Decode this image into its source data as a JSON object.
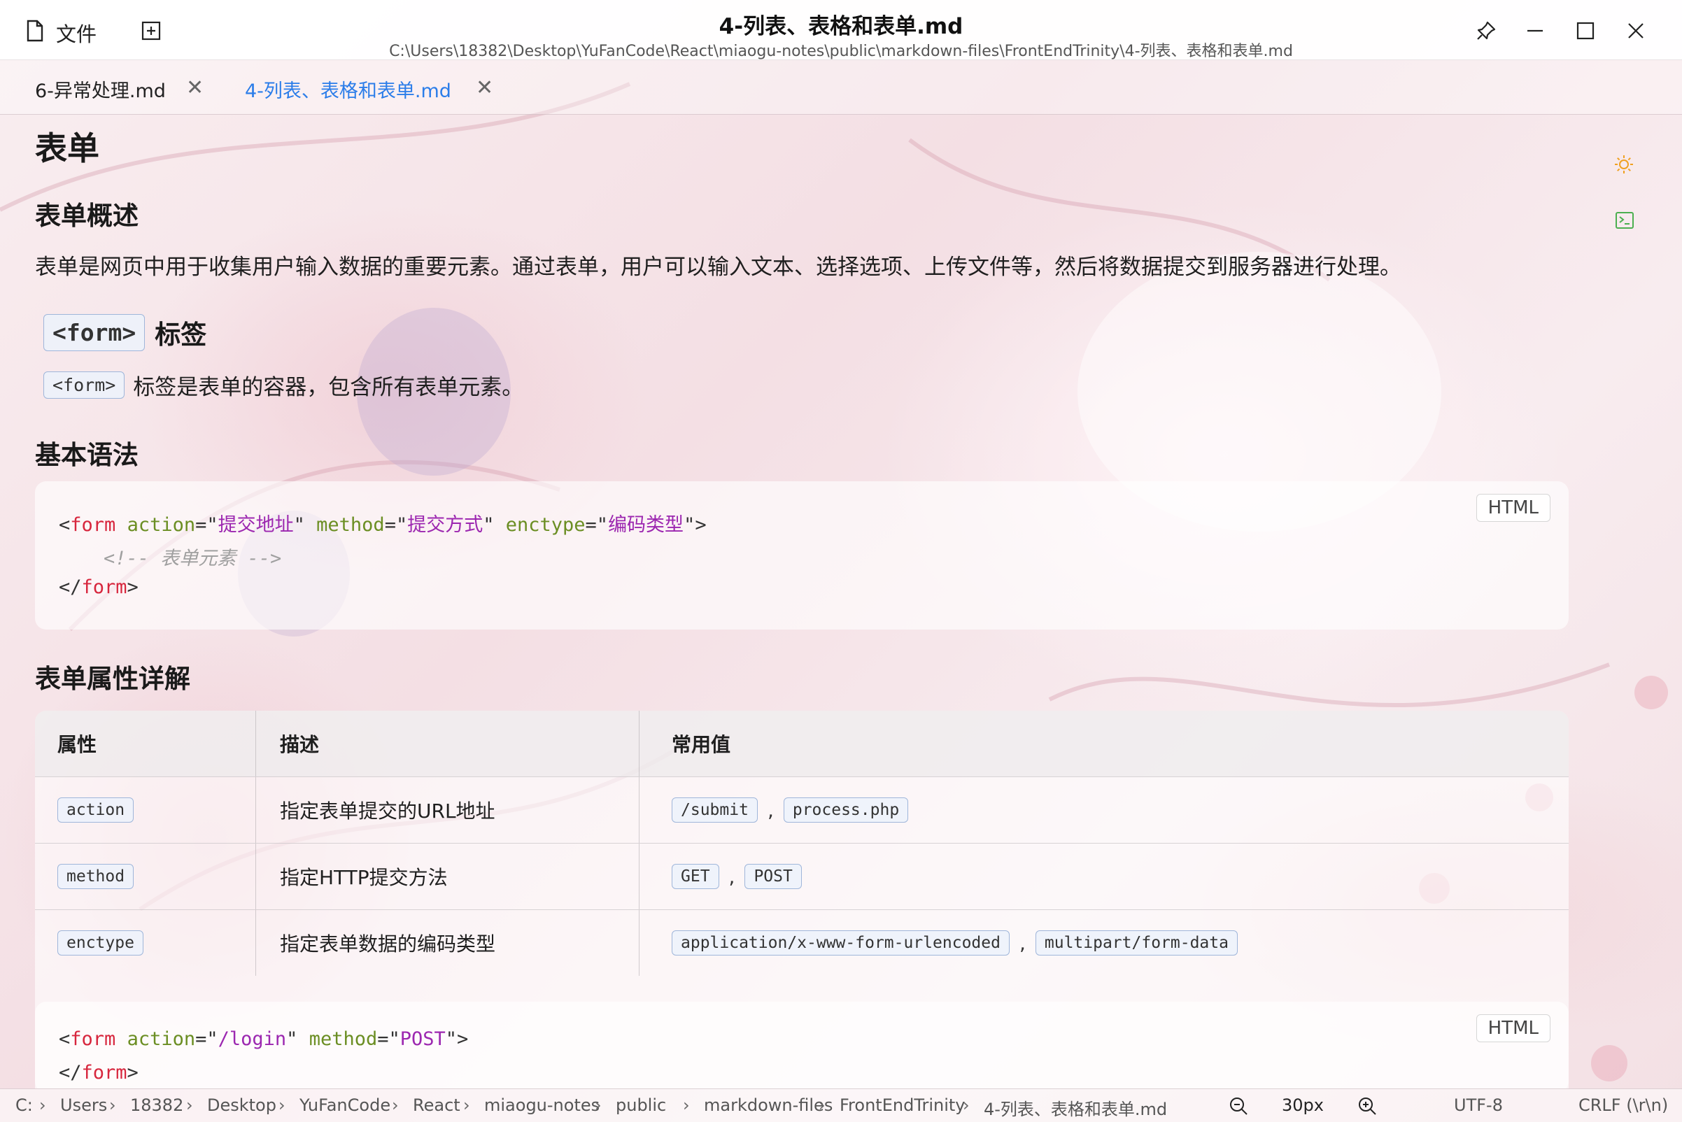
{
  "titlebar": {
    "file_label": "文件",
    "title": "4-列表、表格和表单.md",
    "path": "C:\\Users\\18382\\Desktop\\YuFanCode\\React\\miaogu-notes\\public\\markdown-files\\FrontEndTrinity\\4-列表、表格和表单.md"
  },
  "tabs": [
    {
      "label": "6-异常处理.md",
      "active": false
    },
    {
      "label": "4-列表、表格和表单.md",
      "active": true
    }
  ],
  "doc": {
    "h1": "表单",
    "h2_overview": "表单概述",
    "p_overview": "表单是网页中用于收集用户输入数据的重要元素。通过表单，用户可以输入文本、选择选项、上传文件等，然后将数据提交到服务器进行处理。",
    "h2_formtag_code": "<form>",
    "h2_formtag_text": "标签",
    "p_formtag_code": "<form>",
    "p_formtag_text": "标签是表单的容器，包含所有表单元素。",
    "h2_syntax": "基本语法",
    "h2_attrs": "表单属性详解"
  },
  "code1": {
    "lang": "HTML",
    "l1": {
      "lt": "<",
      "tag": "form",
      "a1": "action",
      "eq1": "=\"",
      "v1": "提交地址",
      "q1": "\"",
      "a2": "method",
      "eq2": "=\"",
      "v2": "提交方式",
      "q2": "\"",
      "a3": "enctype",
      "eq3": "=\"",
      "v3": "编码类型",
      "q3": "\">"
    },
    "l2": "<!-- 表单元素 -->",
    "l3": {
      "lt": "</",
      "tag": "form",
      "gt": ">"
    }
  },
  "table": {
    "headers": [
      "属性",
      "描述",
      "常用值"
    ],
    "rows": [
      {
        "attr": "action",
        "desc": "指定表单提交的URL地址",
        "values": [
          "/submit",
          "process.php"
        ]
      },
      {
        "attr": "method",
        "desc": "指定HTTP提交方法",
        "values": [
          "GET",
          "POST"
        ]
      },
      {
        "attr": "enctype",
        "desc": "指定表单数据的编码类型",
        "values": [
          "application/x-www-form-urlencoded",
          "multipart/form-data"
        ]
      }
    ],
    "separator": ","
  },
  "code2": {
    "lang": "HTML",
    "l1": {
      "lt": "<",
      "tag": "form",
      "a1": "action",
      "eq1": "=\"",
      "v1": "/login",
      "q1": "\"",
      "a2": "method",
      "eq2": "=\"",
      "v2": "POST",
      "q2": "\">"
    },
    "l2": {
      "lt": "</",
      "tag": "form",
      "gt": ">"
    }
  },
  "statusbar": {
    "breadcrumb": [
      "C:",
      "Users",
      "18382",
      "Desktop",
      "YuFanCode",
      "React",
      "miaogu-notes",
      "public",
      "markdown-files",
      "FrontEndTrinity",
      "4-列表、表格和表单.md"
    ],
    "zoom": "30px",
    "encoding": "UTF-8",
    "line_ending": "CRLF (\\r\\n)"
  },
  "colors": {
    "accent": "#2b7de9",
    "tag": "#d7263d",
    "attr": "#6b8e23",
    "string": "#9c27b0",
    "sun_icon": "#f0a020",
    "terminal_icon": "#4caf50"
  }
}
